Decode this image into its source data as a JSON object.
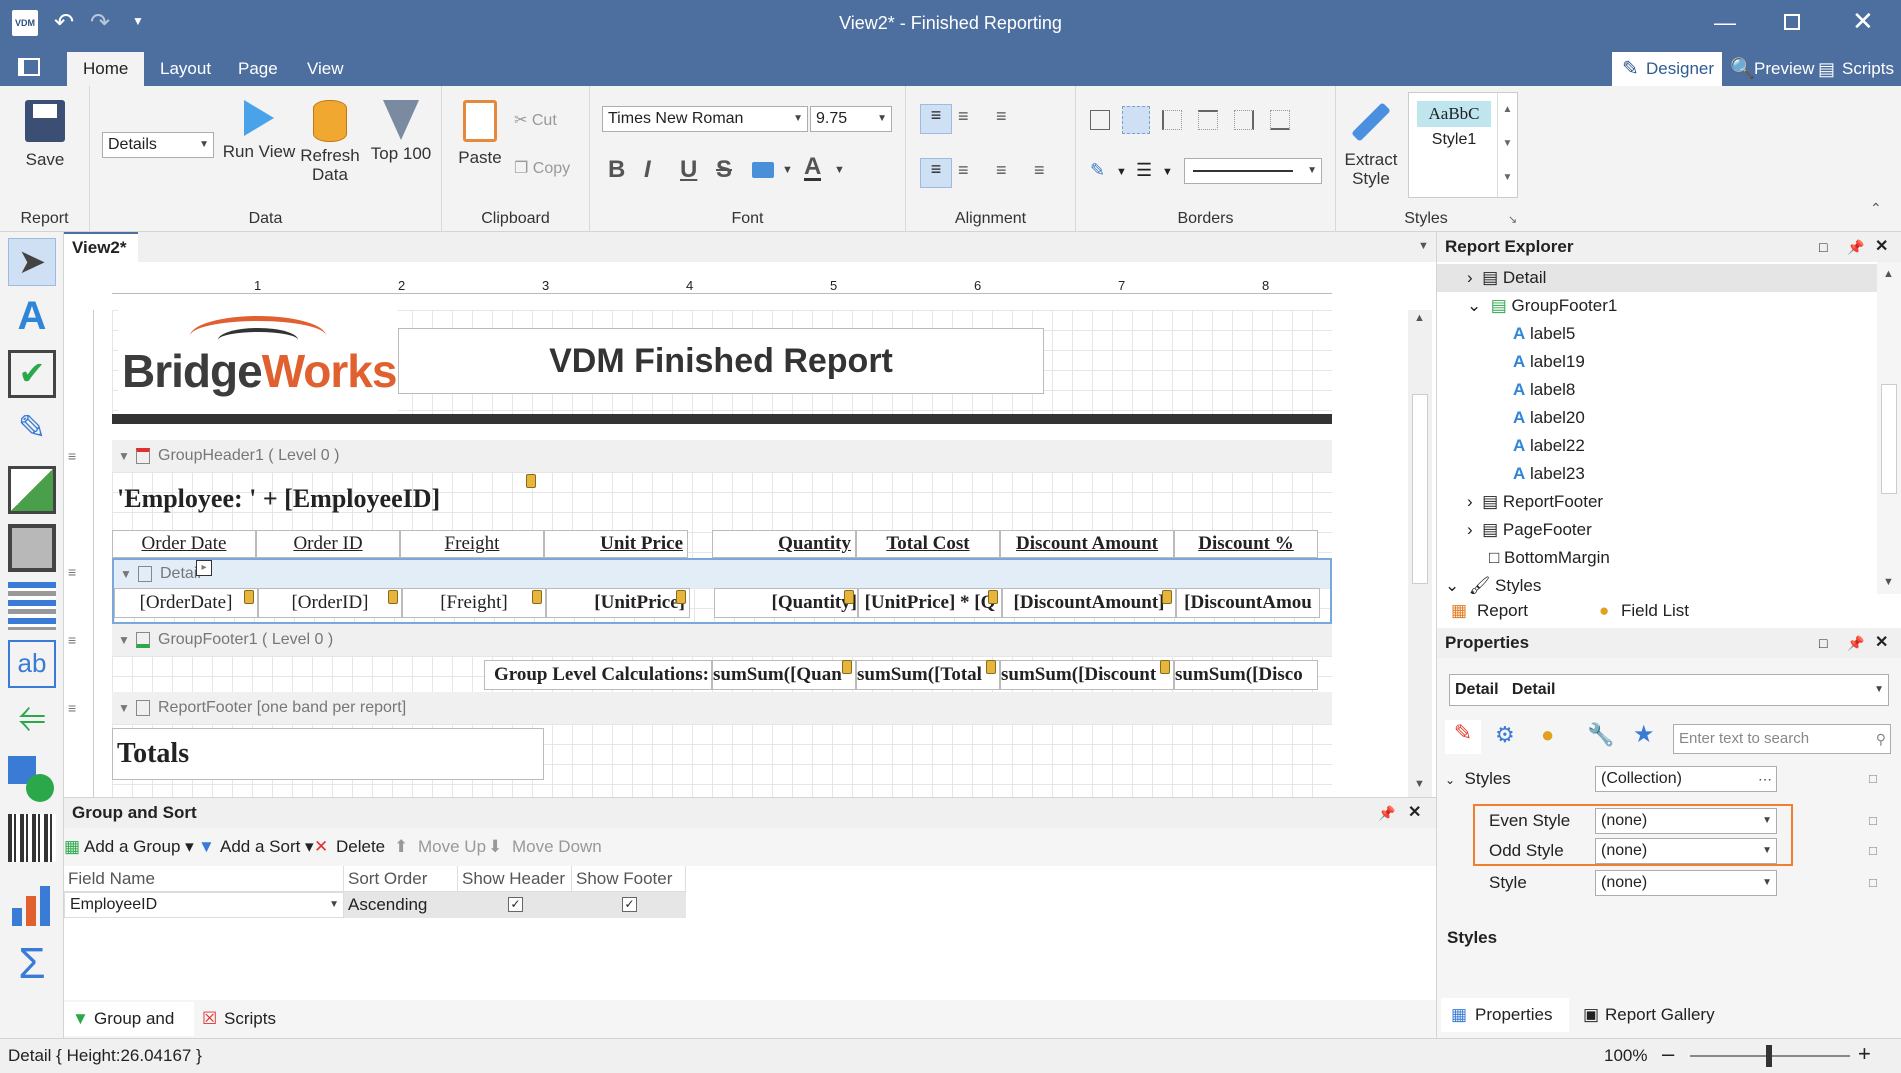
{
  "window": {
    "title": "View2* - Finished Reporting",
    "logo": "VDM"
  },
  "tabs": [
    "Home",
    "Layout",
    "Page",
    "View"
  ],
  "view_modes": [
    "Designer",
    "Preview",
    "Scripts"
  ],
  "ribbon": {
    "report": {
      "save": "Save",
      "label": "Report"
    },
    "data": {
      "details_combo": "Details",
      "run_view": "Run View",
      "refresh_data": "Refresh Data",
      "top100": "Top 100",
      "label": "Data"
    },
    "clipboard": {
      "paste": "Paste",
      "cut": "Cut",
      "copy": "Copy",
      "label": "Clipboard"
    },
    "font": {
      "family": "Times New Roman",
      "size": "9.75",
      "label": "Font"
    },
    "alignment": {
      "label": "Alignment"
    },
    "borders": {
      "label": "Borders"
    },
    "styles": {
      "extract": "Extract Style",
      "preview": "AaBbC",
      "style_name": "Style1",
      "label": "Styles"
    }
  },
  "document": {
    "tab": "View2*",
    "ruler": [
      "1",
      "2",
      "3",
      "4",
      "5",
      "6",
      "7",
      "8"
    ]
  },
  "report": {
    "logo_text_a": "Bridge",
    "logo_text_b": "Works",
    "title": "VDM Finished Report",
    "group_header": "GroupHeader1 ( Level 0 )",
    "employee": "'Employee: ' + [EmployeeID]",
    "columns": [
      "Order Date",
      "Order ID",
      "Freight",
      "Unit Price",
      "Quantity",
      "Total Cost",
      "Discount Amount",
      "Discount %"
    ],
    "detail_band": "Detail",
    "detail_cells": [
      "[OrderDate]",
      "[OrderID]",
      "[Freight]",
      "[UnitPrice]",
      "[Quantity]",
      "[UnitPrice] * [Q",
      "[DiscountAmount]",
      "[DiscountAmou"
    ],
    "group_footer": "GroupFooter1 ( Level 0 )",
    "group_calc_label": "Group Level Calculations:",
    "group_calc_cells": [
      "sumSum([Quan",
      "sumSum([Total",
      "sumSum([Discount",
      "sumSum([Disco"
    ],
    "report_footer": "ReportFooter [one band per report]",
    "totals": "Totals"
  },
  "explorer": {
    "title": "Report Explorer",
    "items": [
      "Detail",
      "GroupFooter1",
      "label5",
      "label19",
      "label8",
      "label20",
      "label22",
      "label23",
      "ReportFooter",
      "PageFooter",
      "BottomMargin",
      "Styles"
    ],
    "tabs": [
      "Report Explorer",
      "Field List"
    ]
  },
  "properties": {
    "title": "Properties",
    "selector_type": "Detail",
    "selector_name": "Detail",
    "search_placeholder": "Enter text to search",
    "rows": [
      {
        "name": "Styles",
        "value": "(Collection)"
      },
      {
        "name": "Even Style",
        "value": "(none)"
      },
      {
        "name": "Odd Style",
        "value": "(none)"
      },
      {
        "name": "Style",
        "value": "(none)"
      }
    ],
    "desc_title": "Styles",
    "tabs": [
      "Properties",
      "Report Gallery"
    ]
  },
  "group_sort": {
    "title": "Group and Sort",
    "actions": [
      "Add a Group",
      "Add a Sort",
      "Delete",
      "Move Up",
      "Move Down"
    ],
    "headers": [
      "Field Name",
      "Sort Order",
      "Show Header",
      "Show Footer"
    ],
    "row": {
      "field": "EmployeeID",
      "order": "Ascending"
    },
    "tabs": [
      "Group and Sort",
      "Scripts Errors"
    ]
  },
  "status": {
    "text": "Detail { Height:26.04167 }",
    "zoom": "100%"
  },
  "colors": {
    "titlebar": "#4d6f9f",
    "accent": "#f08030",
    "band_selected": "#e3edf8"
  }
}
